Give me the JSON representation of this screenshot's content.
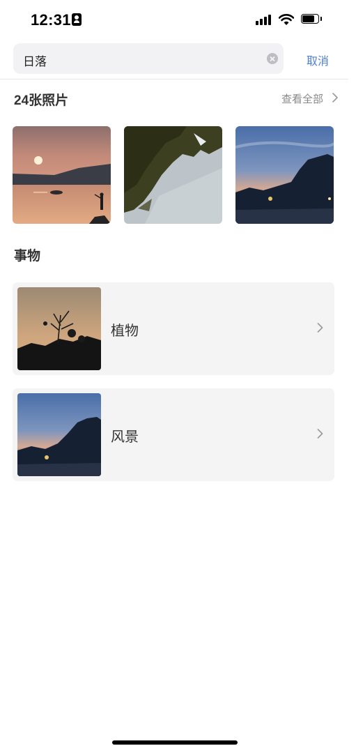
{
  "status_bar": {
    "time": "12:31",
    "battery_level": 0.75
  },
  "search": {
    "query": "日落",
    "cancel_label": "取消"
  },
  "photos": {
    "title": "24张照片",
    "see_all_label": "查看全部"
  },
  "things": {
    "title": "事物",
    "items": [
      {
        "label": "植物"
      },
      {
        "label": "风景"
      }
    ]
  }
}
